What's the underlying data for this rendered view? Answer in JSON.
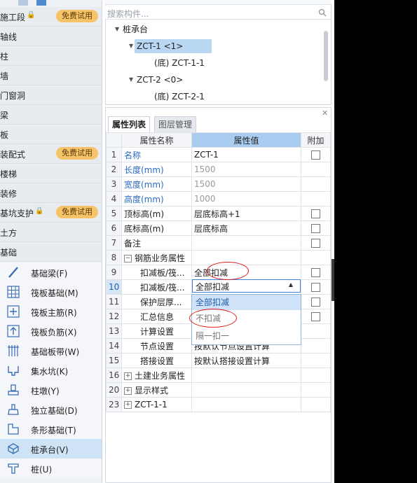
{
  "sidebar": {
    "categories": [
      {
        "label": "施工段",
        "lock": true,
        "badge": "免费试用"
      },
      {
        "label": "轴线"
      },
      {
        "label": "柱"
      },
      {
        "label": "墙"
      },
      {
        "label": "门窗洞"
      },
      {
        "label": "梁"
      },
      {
        "label": "板"
      },
      {
        "label": "装配式",
        "badge": "免费试用"
      },
      {
        "label": "楼梯"
      },
      {
        "label": "装修"
      },
      {
        "label": "基坑支护",
        "lock": true,
        "badge": "免费试用"
      },
      {
        "label": "土方"
      },
      {
        "label": "基础"
      }
    ],
    "items": [
      {
        "label": "基础梁(F)",
        "icon": "foundation-beam-icon"
      },
      {
        "label": "筏板基础(M)",
        "icon": "raft-foundation-icon"
      },
      {
        "label": "筏板主筋(R)",
        "icon": "raft-main-rebar-icon"
      },
      {
        "label": "筏板负筋(X)",
        "icon": "raft-negative-rebar-icon"
      },
      {
        "label": "基础板带(W)",
        "icon": "foundation-strip-icon"
      },
      {
        "label": "集水坑(K)",
        "icon": "sump-pit-icon"
      },
      {
        "label": "柱墩(Y)",
        "icon": "column-pier-icon"
      },
      {
        "label": "独立基础(D)",
        "icon": "isolated-foundation-icon"
      },
      {
        "label": "条形基础(T)",
        "icon": "strip-foundation-icon"
      },
      {
        "label": "桩承台(V)",
        "icon": "pile-cap-icon",
        "selected": true
      },
      {
        "label": "桩(U)",
        "icon": "pile-icon"
      }
    ]
  },
  "tree": {
    "search_placeholder": "搜索构件...",
    "root": "桩承台",
    "nodes": [
      {
        "label": "ZCT-1 <1>",
        "selected": true
      },
      {
        "label": "(底)  ZCT-1-1"
      },
      {
        "label": "ZCT-2 <0>"
      },
      {
        "label": "(底)  ZCT-2-1"
      }
    ]
  },
  "props": {
    "tabs": [
      "属性列表",
      "图层管理"
    ],
    "columns": {
      "name": "属性名称",
      "value": "属性值",
      "extra": "附加"
    },
    "rows": [
      {
        "num": "1",
        "name": "名称",
        "value": "ZCT-1",
        "name_style": "blue",
        "check": true
      },
      {
        "num": "2",
        "name": "长度(mm)",
        "value": "1500",
        "name_style": "blue",
        "value_style": "gray"
      },
      {
        "num": "3",
        "name": "宽度(mm)",
        "value": "1500",
        "name_style": "blue",
        "value_style": "gray"
      },
      {
        "num": "4",
        "name": "高度(mm)",
        "value": "1000",
        "name_style": "blue",
        "value_style": "gray"
      },
      {
        "num": "5",
        "name": "顶标高(m)",
        "value": "层底标高+1",
        "check": true
      },
      {
        "num": "6",
        "name": "底标高(m)",
        "value": "层底标高",
        "check": true
      },
      {
        "num": "7",
        "name": "备注",
        "value": "",
        "check": true
      },
      {
        "num": "8",
        "name": "钢筋业务属性",
        "value": "",
        "group": "minus"
      },
      {
        "num": "9",
        "name": "扣减板/筏...",
        "value": "全部扣减",
        "indent": true,
        "check": true
      },
      {
        "num": "10",
        "name": "扣减板/筏...",
        "value": "全部扣减",
        "indent": true,
        "check": true,
        "current": true
      },
      {
        "num": "11",
        "name": "保护层厚...",
        "value": "",
        "indent": true,
        "check": true
      },
      {
        "num": "12",
        "name": "汇总信息",
        "value": "",
        "indent": true,
        "check": true
      },
      {
        "num": "13",
        "name": "计算设置",
        "value": "",
        "indent": true
      },
      {
        "num": "14",
        "name": "节点设置",
        "value": "按默认节点设置计算",
        "indent": true
      },
      {
        "num": "15",
        "name": "搭接设置",
        "value": "按默认搭接设置计算",
        "indent": true
      },
      {
        "num": "16",
        "name": "土建业务属性",
        "value": "",
        "group": "plus"
      },
      {
        "num": "20",
        "name": "显示样式",
        "value": "",
        "group": "plus"
      },
      {
        "num": "23",
        "name": "ZCT-1-1",
        "value": "",
        "group": "plus"
      }
    ],
    "dropdown": {
      "current": "全部扣减",
      "options": [
        "全部扣减",
        "不扣减",
        "隔一扣一"
      ],
      "selected_index": 0
    }
  }
}
